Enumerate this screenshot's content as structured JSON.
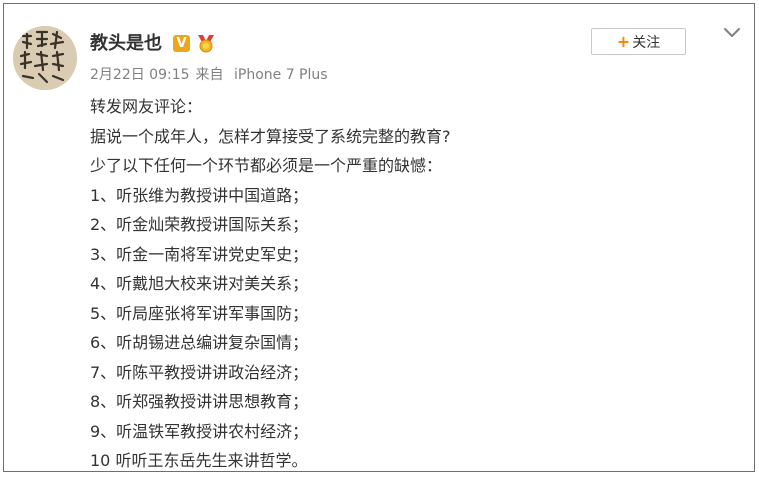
{
  "post": {
    "author": {
      "name": "教头是也",
      "verified_badge": "V",
      "badge_icons": [
        "vip-v-icon",
        "medal-icon"
      ],
      "avatar": "calligraphy-avatar"
    },
    "meta": {
      "date": "2月22日 09:15",
      "source_prefix": "来自",
      "device": "iPhone 7 Plus"
    },
    "follow_button": {
      "icon": "+",
      "label": "关注"
    },
    "menu_icon": "chevron-down-icon",
    "content_lines": [
      "转发网友评论：",
      "据说一个成年人，怎样才算接受了系统完整的教育?",
      "少了以下任何一个环节都必须是一个严重的缺憾：",
      "1、听张维为教授讲中国道路；",
      "2、听金灿荣教授讲国际关系；",
      "3、听金一南将军讲党史军史；",
      "4、听戴旭大校来讲对美关系；",
      "5、听局座张将军讲军事国防；",
      "6、听胡锡进总编讲复杂国情；",
      "7、听陈平教授讲讲政治经济；",
      "8、听郑强教授讲讲思想教育；",
      "9、听温铁军教授讲农村经济；",
      "10  听听王东岳先生来讲哲学。"
    ]
  },
  "colors": {
    "username": "#333333",
    "meta": "#808080",
    "body_text": "#333333",
    "follow_plus": "#ff8200",
    "vip_badge": "#f0a61c",
    "border": "#6f6f6f"
  }
}
